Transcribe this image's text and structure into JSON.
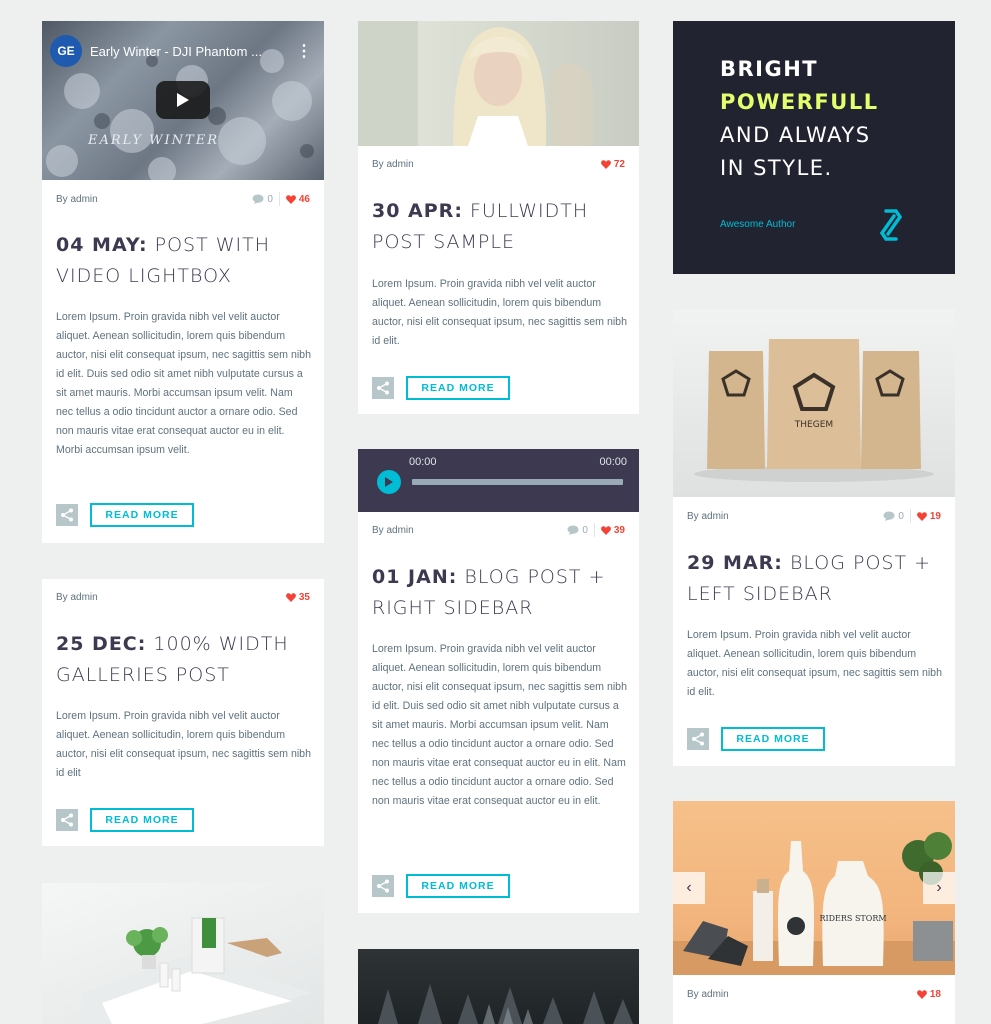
{
  "colors": {
    "accent": "#00bcd4",
    "likes": "#f44336",
    "heading": "#3c3950",
    "dark_bg": "#212331",
    "highlight": "#e4ff6b"
  },
  "common": {
    "by": "By admin",
    "read_more": "READ MORE"
  },
  "posts": {
    "p1": {
      "video_channel": "GE",
      "video_title": "Early Winter - DJI Phantom ...",
      "video_overlay": "EARLY WINTER",
      "comments": "0",
      "likes": "46",
      "date": "04 MAY:",
      "title": "POST WITH VIDEO LIGHTBOX",
      "excerpt": "Lorem Ipsum. Proin gravida nibh vel velit auctor aliquet. Aenean sollicitudin, lorem quis bibendum auctor, nisi elit consequat ipsum, nec sagittis sem nibh id elit. Duis sed odio sit amet nibh vulputate cursus a sit amet mauris. Morbi accumsan ipsum velit. Nam nec tellus a odio tincidunt auctor a ornare odio. Sed non mauris vitae erat consequat auctor eu in elit. Morbi accumsan ipsum velit."
    },
    "p2": {
      "likes": "35",
      "date": "25 DEC:",
      "title": "100% WIDTH GALLERIES POST",
      "excerpt": "Lorem Ipsum. Proin gravida nibh vel velit auctor aliquet. Aenean sollicitudin, lorem quis bibendum auctor, nisi elit consequat ipsum, nec sagittis sem nibh id elit"
    },
    "p3": {
      "likes": "72",
      "date": "30 APR:",
      "title": "FULLWIDTH POST SAMPLE",
      "excerpt": "Lorem Ipsum. Proin gravida nibh vel velit auctor aliquet. Aenean sollicitudin, lorem quis bibendum auctor, nisi elit consequat ipsum, nec sagittis sem nibh id elit."
    },
    "p4": {
      "time_current": "00:00",
      "time_total": "00:00",
      "comments": "0",
      "likes": "39",
      "date": "01 JAN:",
      "title": "BLOG POST + RIGHT SIDEBAR",
      "excerpt": "Lorem Ipsum. Proin gravida nibh vel velit auctor aliquet. Aenean sollicitudin, lorem quis bibendum auctor, nisi elit consequat ipsum, nec sagittis sem nibh id elit. Duis sed odio sit amet nibh vulputate cursus a sit amet mauris. Morbi accumsan ipsum velit. Nam nec tellus a odio tincidunt auctor a ornare odio. Sed non mauris vitae erat consequat auctor eu in elit. Nam nec tellus a odio tincidunt auctor a ornare odio. Sed non mauris vitae erat consequat auctor eu in elit."
    },
    "promo": {
      "line1": "BRIGHT",
      "line2": "POWERFULL",
      "line3": "AND ALWAYS",
      "line4": "IN STYLE.",
      "author": "Awesome Author"
    },
    "p5": {
      "brand": "THEGEM",
      "comments": "0",
      "likes": "19",
      "date": "29 MAR:",
      "title": "BLOG POST + LEFT SIDEBAR",
      "excerpt": "Lorem Ipsum. Proin gravida nibh vel velit auctor aliquet. Aenean sollicitudin, lorem quis bibendum auctor, nisi elit consequat ipsum, nec sagittis sem nibh id elit."
    },
    "p6": {
      "bottle_label": "RIDERS STORM",
      "likes": "18"
    }
  }
}
